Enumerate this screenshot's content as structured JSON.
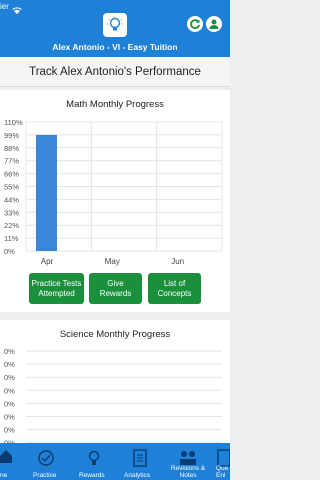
{
  "status": {
    "carrier": "ier"
  },
  "header": {
    "title": "Alex Antonio - VI - Easy Tuition"
  },
  "track_title": "Track Alex Antonio's Performance",
  "math_card": {
    "title": "Math Monthly Progress"
  },
  "chart_data": [
    {
      "type": "bar",
      "title": "Math Monthly Progress",
      "categories": [
        "Apr",
        "May",
        "Jun"
      ],
      "values": [
        99,
        0,
        0
      ],
      "ytick_labels": [
        "110%",
        "99%",
        "88%",
        "77%",
        "66%",
        "55%",
        "44%",
        "33%",
        "22%",
        "11%",
        "0%"
      ],
      "ylim": [
        0,
        110
      ],
      "bar_color": "#3a86d8",
      "grid": true
    },
    {
      "type": "bar",
      "title": "Science Monthly Progress",
      "categories": [],
      "values": [],
      "ytick_labels": [
        "0%",
        "0%",
        "0%",
        "0%",
        "0%",
        "0%",
        "0%",
        "0%"
      ],
      "grid": true
    }
  ],
  "buttons": {
    "practice": "Practice Tests Attempted",
    "rewards": "Give Rewards",
    "concepts": "List of Concepts"
  },
  "science_card": {
    "title": "Science Monthly Progress"
  },
  "nav": {
    "items": [
      {
        "label": "ne",
        "icon": "home-icon"
      },
      {
        "label": "Practice",
        "icon": "practice-icon"
      },
      {
        "label": "Rewards",
        "icon": "rewards-icon"
      },
      {
        "label": "Analytics",
        "icon": "analytics-icon"
      },
      {
        "label": "Revisions & Notes",
        "icon": "revisions-icon"
      },
      {
        "label": "Que Enl",
        "icon": "questions-icon"
      }
    ]
  },
  "colors": {
    "header": "#1f80d8",
    "button": "#1a8f3c",
    "bar": "#3a86d8"
  }
}
